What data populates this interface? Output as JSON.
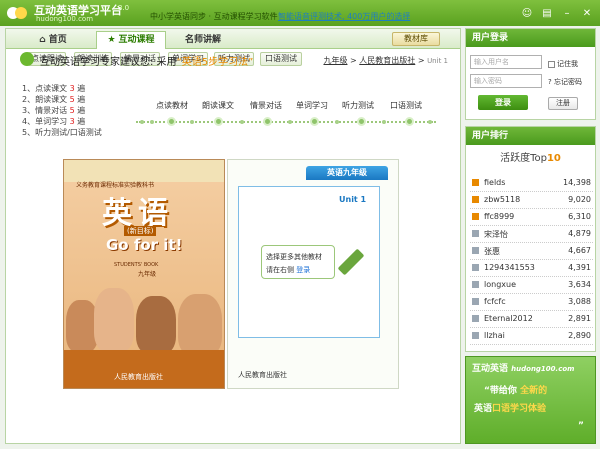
{
  "app": {
    "title": "互动英语学习平台",
    "version": "3.0",
    "site": "hudong100.com",
    "slogan": "中小学英语同步 · 互动课程学习软件",
    "promo": "智能语音评测技术, 400万用户的选择"
  },
  "tabs": [
    {
      "label": "首页",
      "icon": "home-icon"
    },
    {
      "label": "互动课程",
      "icon": "star-icon"
    },
    {
      "label": "名师讲解",
      "icon": "teacher-icon"
    }
  ],
  "library_label": "教材库",
  "subnav": [
    "点读跟读",
    "朗读训练",
    "情景对话",
    "单词学习",
    "听力测试",
    "口语测试"
  ],
  "breadcrumb": {
    "grade": "九年级",
    "publisher": "人民教育出版社",
    "unit": "Unit 1"
  },
  "advice": {
    "prefix": "互动英语学习专家建议您: 采用",
    "highlight": "“英语5步学习法”"
  },
  "steps": [
    {
      "text": "1、点读课文",
      "count": "3",
      "unit": "遍"
    },
    {
      "text": "2、朗读课文",
      "count": "5",
      "unit": "遍"
    },
    {
      "text": "3、情景对话",
      "count": "5",
      "unit": "遍"
    },
    {
      "text": "4、单词学习",
      "count": "3",
      "unit": "遍"
    },
    {
      "text": "5、听力测试/口语测试",
      "count": "",
      "unit": ""
    }
  ],
  "flow": [
    "点读教材",
    "朗读课文",
    "情景对话",
    "单词学习",
    "听力测试",
    "口语测试"
  ],
  "book": {
    "cover_subtitle": "义务教育课程标准实验教科书",
    "cover_title": "英语",
    "cover_tag": "(新目标)",
    "cover_en": "Go for it!",
    "cover_books": "STUDENTS' BOOK",
    "cover_grade": "九年级",
    "cover_pub": "人民教育出版社",
    "grade_tab": "英语九年级",
    "unit": "Unit 1",
    "hint_line1": "选择更多其他教材",
    "hint_line2_prefix": "请在右侧",
    "hint_link": "登录",
    "right_pub": "人民教育出版社"
  },
  "login": {
    "title": "用户登录",
    "username_placeholder": "输入用户名",
    "password_placeholder": "输入密码",
    "remember": "记住我",
    "forgot": "忘记密码",
    "login_btn": "登录",
    "register_btn": "注册"
  },
  "ranking": {
    "title": "用户排行",
    "subtitle": "活跃度Top",
    "top_n": "10",
    "rows": [
      {
        "name": "fields",
        "score": "14,398"
      },
      {
        "name": "zbw5118",
        "score": "9,020"
      },
      {
        "name": "ffc8999",
        "score": "6,310"
      },
      {
        "name": "宋泽怡",
        "score": "4,879"
      },
      {
        "name": "张惠",
        "score": "4,667"
      },
      {
        "name": "1294341553",
        "score": "4,391"
      },
      {
        "name": "longxue",
        "score": "3,634"
      },
      {
        "name": "fcfcfc",
        "score": "3,088"
      },
      {
        "name": "Eternal2012",
        "score": "2,891"
      },
      {
        "name": "llzhai",
        "score": "2,890"
      }
    ]
  },
  "banner": {
    "brand": "互动英语",
    "site": "hudong100.com",
    "line1_a": "“带给你",
    "line1_b": "全新的",
    "line2_a": "英语",
    "line2_b": "口语学习体验",
    "line3": "”"
  }
}
